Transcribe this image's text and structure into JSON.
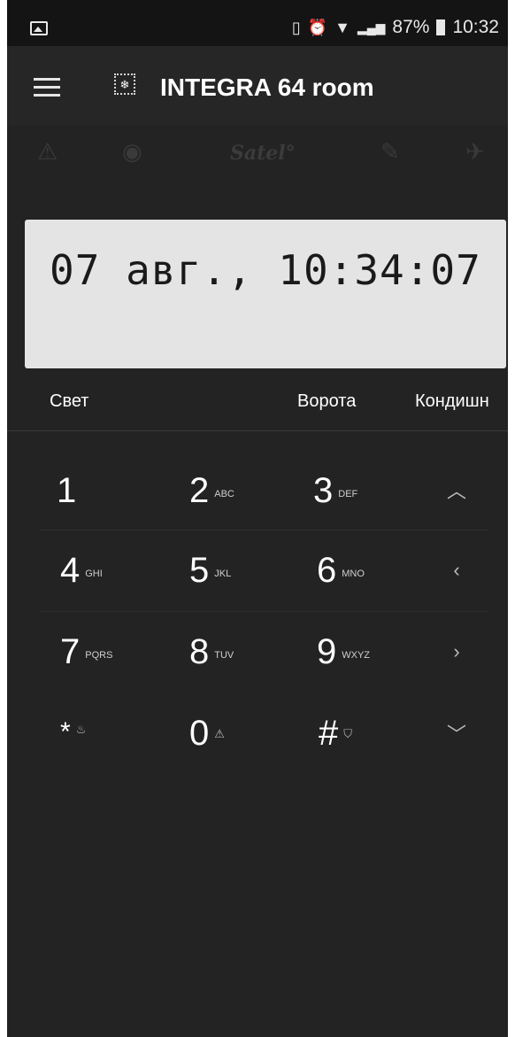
{
  "status_bar": {
    "battery": "87%",
    "time": "10:32",
    "icons": [
      "gallery-icon",
      "vibrate-icon",
      "alarm-icon",
      "wifi-icon",
      "signal-icon",
      "battery-icon"
    ]
  },
  "app_bar": {
    "title": "INTEGRA 64 room",
    "logo_glyph": "❄"
  },
  "toolbar": {
    "brand": "Satel°",
    "icons": [
      "alert-icon",
      "eye-icon",
      "wrench-icon",
      "rocket-icon"
    ]
  },
  "display": {
    "text": "07 авг., 10:34:07"
  },
  "macros": {
    "left": "Свет",
    "middle": "Ворота",
    "right": "Кондишн"
  },
  "keypad": {
    "k1": {
      "digit": "1",
      "sub": ""
    },
    "k2": {
      "digit": "2",
      "sub": "ABC"
    },
    "k3": {
      "digit": "3",
      "sub": "DEF"
    },
    "k4": {
      "digit": "4",
      "sub": "GHI"
    },
    "k5": {
      "digit": "5",
      "sub": "JKL"
    },
    "k6": {
      "digit": "6",
      "sub": "MNO"
    },
    "k7": {
      "digit": "7",
      "sub": "PQRS"
    },
    "k8": {
      "digit": "8",
      "sub": "TUV"
    },
    "k9": {
      "digit": "9",
      "sub": "WXYZ"
    },
    "kstar": {
      "digit": "*",
      "sub_icon": "fire-icon"
    },
    "k0": {
      "digit": "0",
      "sub_icon": "warning-icon"
    },
    "khash": {
      "digit": "#",
      "sub_icon": "shield-icon"
    }
  },
  "arrows": {
    "up": "︿",
    "left": "‹",
    "right": "›",
    "down": "﹀"
  },
  "colors": {
    "background": "#232323",
    "lcd": "#e4e4e4",
    "text": "#ffffff"
  }
}
